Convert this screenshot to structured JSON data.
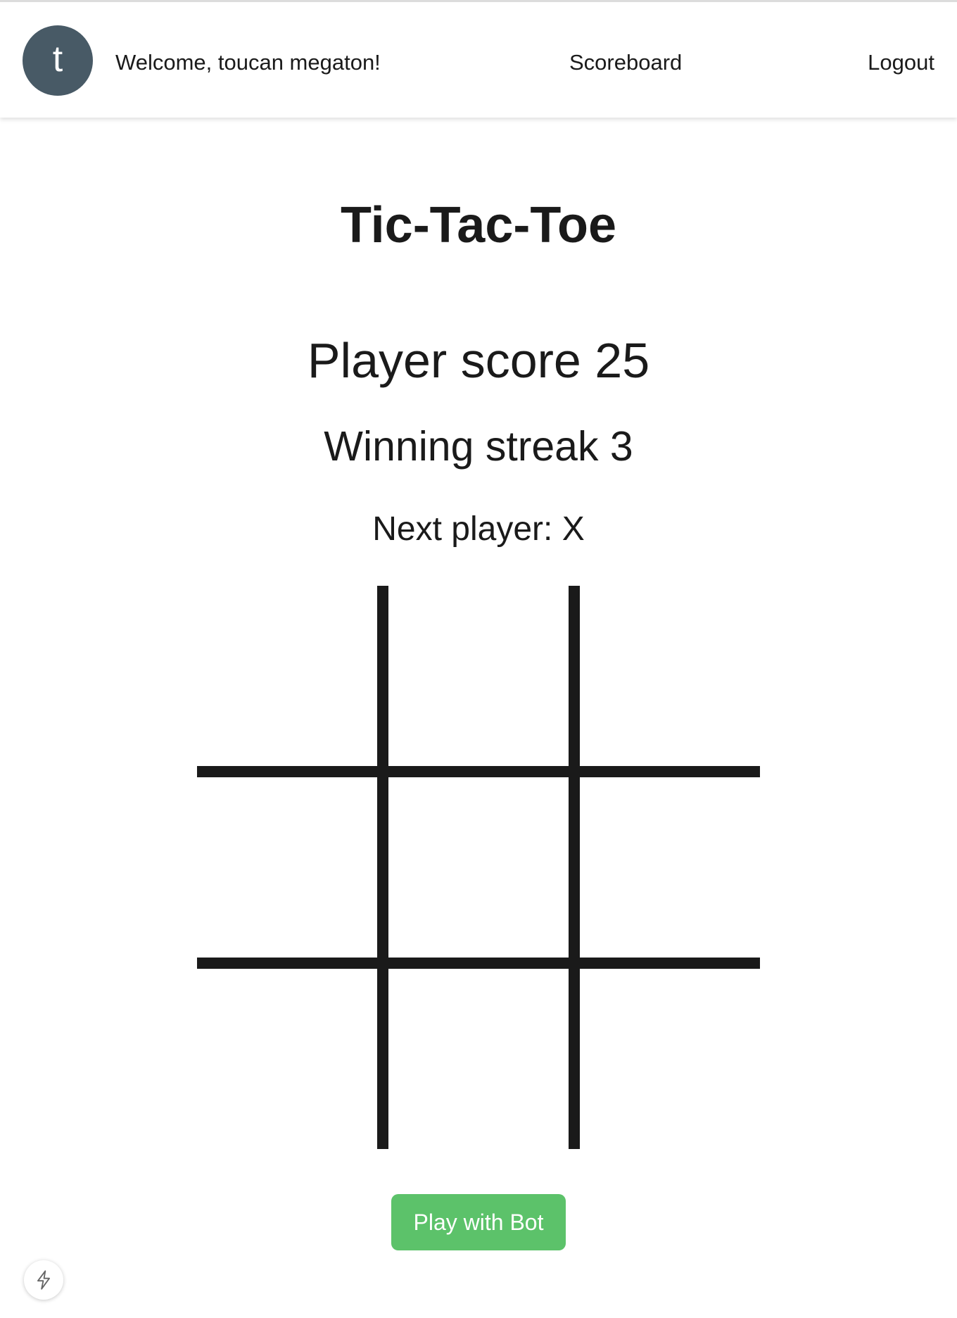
{
  "header": {
    "avatar_initial": "t",
    "welcome_text": "Welcome, toucan megaton!",
    "nav": {
      "scoreboard_label": "Scoreboard",
      "logout_label": "Logout"
    },
    "avatar_color": "#485a66"
  },
  "game": {
    "title": "Tic-Tac-Toe",
    "player_score_text": "Player score 25",
    "winning_streak_text": "Winning streak 3",
    "next_player_text": "Next player: X",
    "board": [
      "",
      "",
      "",
      "",
      "",
      "",
      "",
      "",
      ""
    ],
    "play_bot_label": "Play with Bot",
    "play_bot_color": "#5cc26a"
  },
  "floating": {
    "icon": "lightning-bolt-icon"
  }
}
